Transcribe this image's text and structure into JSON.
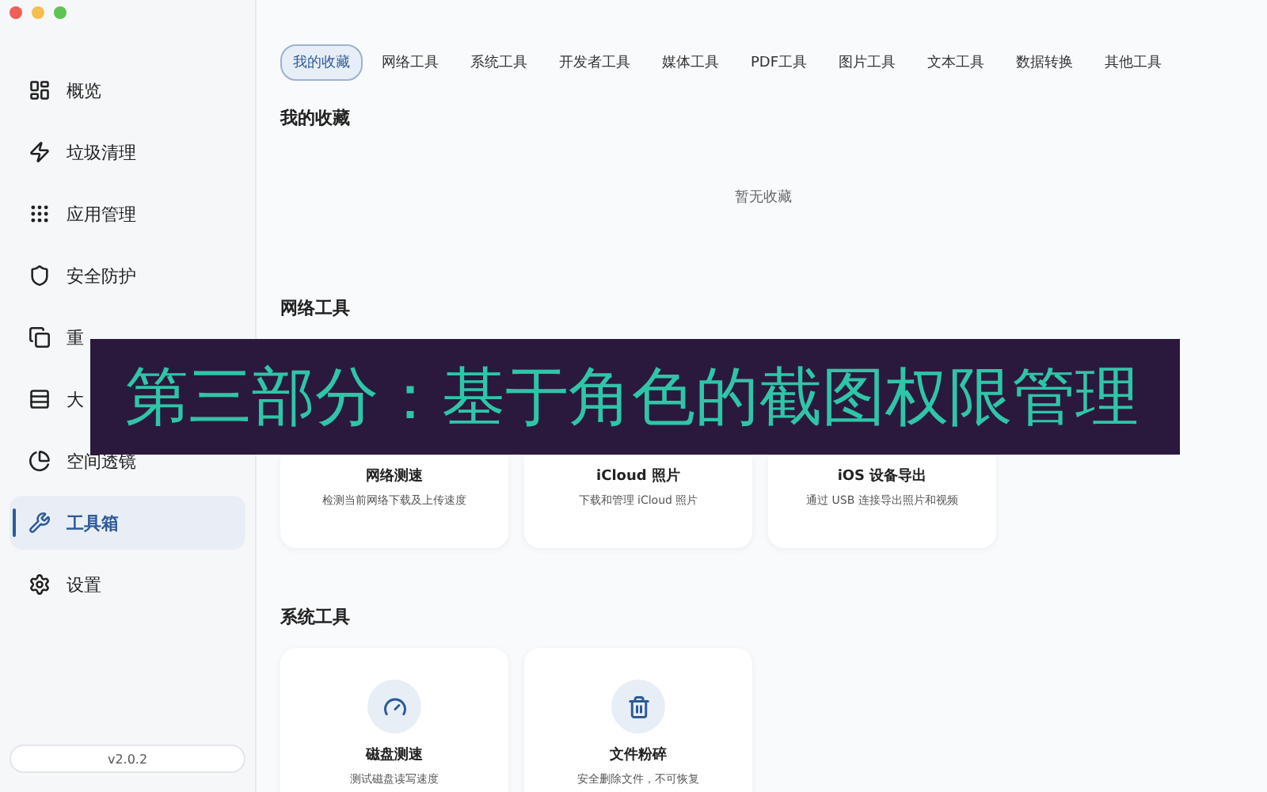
{
  "sidebar": {
    "items": [
      {
        "label": "概览",
        "selected": false
      },
      {
        "label": "垃圾清理",
        "selected": false
      },
      {
        "label": "应用管理",
        "selected": false
      },
      {
        "label": "安全防护",
        "selected": false
      },
      {
        "label": "重",
        "selected": false
      },
      {
        "label": "大",
        "selected": false
      },
      {
        "label": "空间透镜",
        "selected": false
      },
      {
        "label": "工具箱",
        "selected": true
      },
      {
        "label": "设置",
        "selected": false
      }
    ],
    "version": "v2.0.2"
  },
  "tabs": [
    {
      "label": "我的收藏",
      "selected": true
    },
    {
      "label": "网络工具",
      "selected": false
    },
    {
      "label": "系统工具",
      "selected": false
    },
    {
      "label": "开发者工具",
      "selected": false
    },
    {
      "label": "媒体工具",
      "selected": false
    },
    {
      "label": "PDF工具",
      "selected": false
    },
    {
      "label": "图片工具",
      "selected": false
    },
    {
      "label": "文本工具",
      "selected": false
    },
    {
      "label": "数据转换",
      "selected": false
    },
    {
      "label": "其他工具",
      "selected": false
    }
  ],
  "sections": [
    {
      "title": "我的收藏",
      "empty_text": "暂无收藏"
    },
    {
      "title": "网络工具",
      "cards": [
        {
          "title": "网络测速",
          "description": "检测当前网络下载及上传速度"
        },
        {
          "title": "iCloud 照片",
          "description": "下载和管理 iCloud 照片"
        },
        {
          "title": "iOS 设备导出",
          "description": "通过 USB 连接导出照片和视频"
        }
      ]
    },
    {
      "title": "系统工具",
      "cards": [
        {
          "title": "磁盘测速",
          "description": "测试磁盘读写速度"
        },
        {
          "title": "文件粉碎",
          "description": "安全删除文件，不可恢复"
        }
      ]
    }
  ],
  "banner": {
    "text": "第三部分：基于角色的截图权限管理"
  }
}
